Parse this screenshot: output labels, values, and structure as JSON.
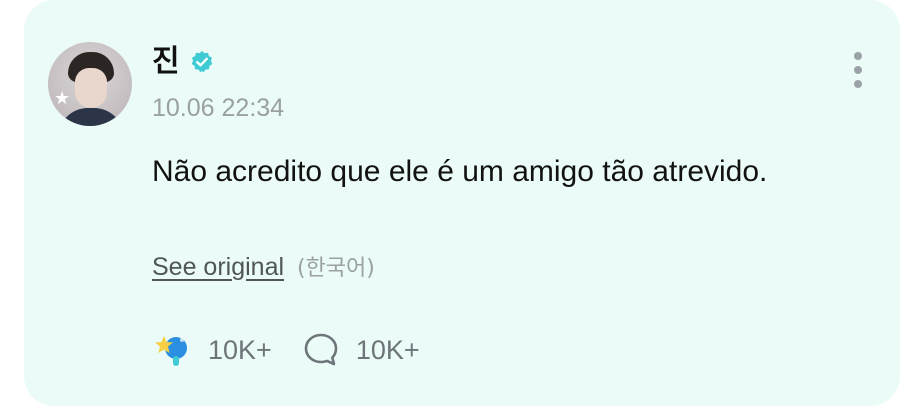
{
  "post": {
    "author": {
      "name": "진",
      "verified": true,
      "avatar_icon": "profile-photo"
    },
    "timestamp": "10.06 22:34",
    "message": "Não acredito que ele é um amigo tão atrevido.",
    "translation": {
      "see_original_label": "See original",
      "original_language": "(한국어)"
    },
    "reactions": {
      "like_icon": "star-cheer-icon",
      "like_count": "10K+",
      "comment_icon": "speech-bubble-icon",
      "comment_count": "10K+"
    }
  },
  "colors": {
    "card_background": "#ebfbf7",
    "verified_badge": "#3ecbd3",
    "accent_blue": "#2a8fe0",
    "accent_yellow": "#f6cf45",
    "muted_text": "#9aa0a4"
  }
}
